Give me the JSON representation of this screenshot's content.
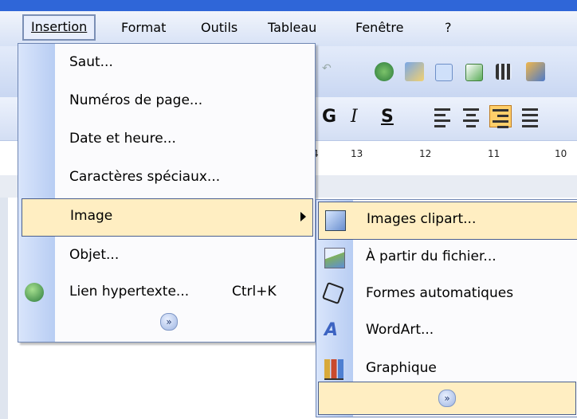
{
  "menubar": {
    "items": [
      {
        "label": "Insertion"
      },
      {
        "label": "Format"
      },
      {
        "label": "Outils"
      },
      {
        "label": "Tableau"
      },
      {
        "label": "Fenêtre"
      },
      {
        "label": "?"
      }
    ]
  },
  "toolbar": {
    "bold": "G",
    "italic": "I",
    "underline": "S"
  },
  "ruler": {
    "ticks": [
      "4",
      "13",
      "12",
      "11",
      "10"
    ]
  },
  "menu": {
    "items": [
      {
        "label": "Saut..."
      },
      {
        "label": "Numéros de page..."
      },
      {
        "label": "Date et heure..."
      },
      {
        "label": "Caractères spéciaux..."
      },
      {
        "label": "Image"
      },
      {
        "label": "Objet..."
      },
      {
        "label": "Lien hypertexte...",
        "shortcut": "Ctrl+K"
      }
    ],
    "more": "»"
  },
  "submenu": {
    "items": [
      {
        "label": "Images clipart...",
        "icon": "clipart-icon"
      },
      {
        "label": "À partir du fichier...",
        "icon": "picture-file-icon"
      },
      {
        "label": "Formes automatiques",
        "icon": "autoshapes-icon"
      },
      {
        "label": "WordArt...",
        "icon": "wordart-icon"
      },
      {
        "label": "Graphique",
        "icon": "chart-icon"
      }
    ],
    "more": "»"
  },
  "colors": {
    "highlight": "#ffeec2",
    "menu_strip": "#c8d9f7",
    "title": "#2f66d8"
  }
}
